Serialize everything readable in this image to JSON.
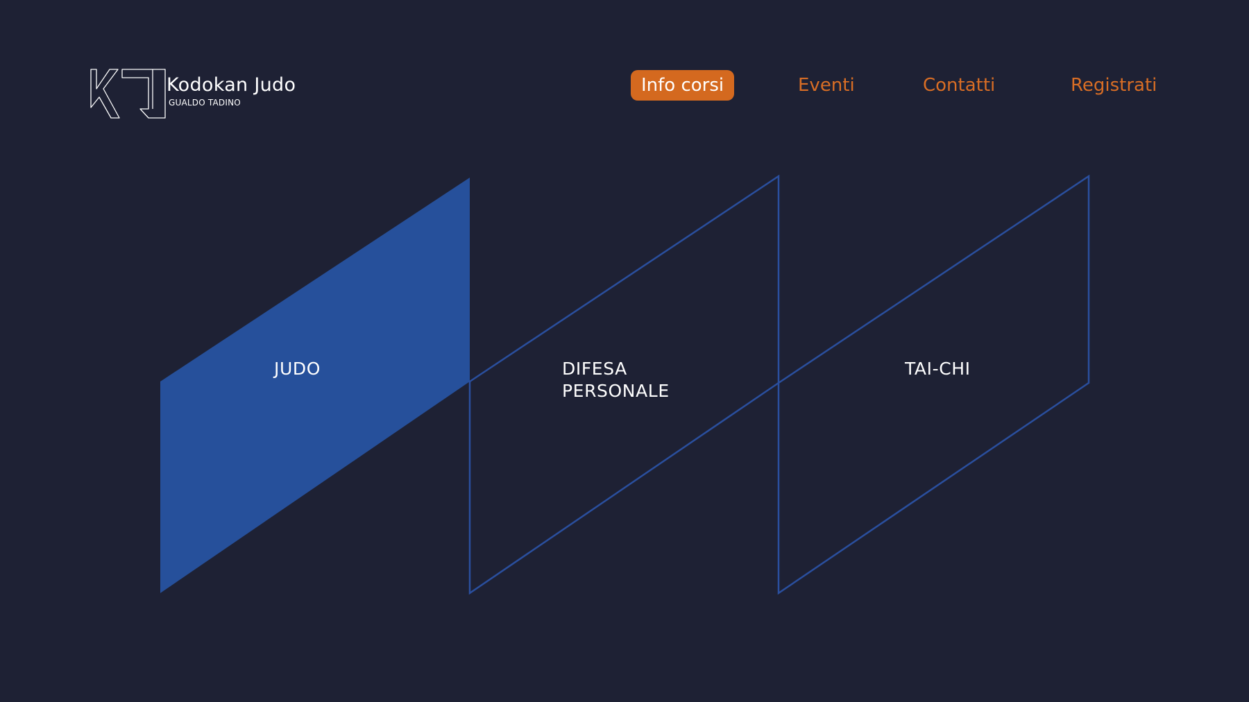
{
  "brand": {
    "title": "Kodokan Judo",
    "subtitle": "GUALDO TADINO",
    "logo_icon": "kj-monogram-icon"
  },
  "nav": {
    "items": [
      {
        "label": "Info corsi",
        "active": true
      },
      {
        "label": "Eventi",
        "active": false
      },
      {
        "label": "Contatti",
        "active": false
      },
      {
        "label": "Registrati",
        "active": false
      }
    ]
  },
  "courses": [
    {
      "line1": "JUDO",
      "line2": "",
      "selected": true
    },
    {
      "line1": "DIFESA",
      "line2": "PERSONALE",
      "selected": false
    },
    {
      "line1": "TAI-CHI",
      "line2": "",
      "selected": false
    }
  ],
  "colors": {
    "background": "#1e2134",
    "accent": "#d4691f",
    "panel_blue": "#26509b",
    "outline_blue": "#2a4f9e",
    "text": "#ffffff"
  }
}
